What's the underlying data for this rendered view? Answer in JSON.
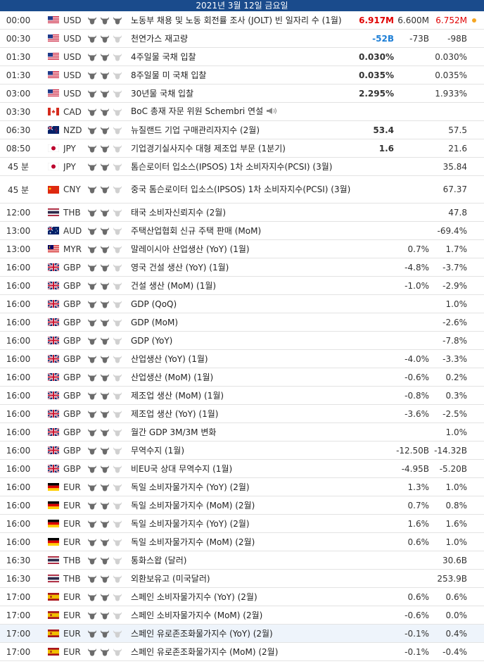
{
  "date_header": "2021년 3월 12일 금요일",
  "colors": {
    "bull_filled": "#6b6b6b",
    "bull_empty": "#d0d0d0",
    "header_bg": "#1a4b8c",
    "red": "#e00000",
    "blue": "#1e7fd6"
  },
  "rows": [
    {
      "time": "00:00",
      "flag": "us",
      "cur": "USD",
      "imp": 3,
      "event": "노동부 채용 및 노동 회전률 조사 (JOLT) 빈 일자리 수 (1월)",
      "actual": "6.917M",
      "actual_color": "red",
      "forecast": "6.600M",
      "previous": "6.752M",
      "previous_color": "red",
      "dot": true
    },
    {
      "time": "00:30",
      "flag": "us",
      "cur": "USD",
      "imp": 2,
      "event": "천연가스 재고량",
      "actual": "-52B",
      "actual_color": "blue",
      "forecast": "-73B",
      "previous": "-98B"
    },
    {
      "time": "01:30",
      "flag": "us",
      "cur": "USD",
      "imp": 2,
      "event": "4주일물 국채 입찰",
      "actual": "0.030%",
      "forecast": "",
      "previous": "0.030%"
    },
    {
      "time": "01:30",
      "flag": "us",
      "cur": "USD",
      "imp": 2,
      "event": "8주일물 미 국채 입찰",
      "actual": "0.035%",
      "forecast": "",
      "previous": "0.035%"
    },
    {
      "time": "03:00",
      "flag": "us",
      "cur": "USD",
      "imp": 2,
      "event": "30년물 국채 입찰",
      "actual": "2.295%",
      "forecast": "",
      "previous": "1.933%"
    },
    {
      "time": "03:30",
      "flag": "ca",
      "cur": "CAD",
      "imp": 2,
      "event": "BoC 총재 자문 위원 Schembri 연설",
      "speaker": true,
      "actual": "",
      "forecast": "",
      "previous": ""
    },
    {
      "time": "06:30",
      "flag": "nz",
      "cur": "NZD",
      "imp": 2,
      "event": "뉴질랜드 기업 구매관리자지수 (2월)",
      "actual": "53.4",
      "forecast": "",
      "previous": "57.5"
    },
    {
      "time": "08:50",
      "flag": "jp",
      "cur": "JPY",
      "imp": 2,
      "event": "기업경기실사지수 대형 제조업 부문 (1분기)",
      "actual": "1.6",
      "forecast": "",
      "previous": "21.6"
    },
    {
      "time": "45 분",
      "flag": "jp",
      "cur": "JPY",
      "imp": 2,
      "event": "톰슨로이터 입소스(IPSOS) 1차 소비자지수(PCSI) (3월)",
      "actual": "",
      "forecast": "",
      "previous": "35.84"
    },
    {
      "time": "45 분",
      "flag": "cn",
      "cur": "CNY",
      "imp": 2,
      "event": "중국 톰슨로이터 입소스(IPSOS) 1차 소비자지수(PCSI) (3월)",
      "tall": true,
      "actual": "",
      "forecast": "",
      "previous": "67.37"
    },
    {
      "time": "12:00",
      "flag": "th",
      "cur": "THB",
      "imp": 2,
      "event": "태국 소비자신뢰지수 (2월)",
      "actual": "",
      "forecast": "",
      "previous": "47.8"
    },
    {
      "time": "13:00",
      "flag": "au",
      "cur": "AUD",
      "imp": 2,
      "event": "주택산업협회 신규 주택 판매 (MoM)",
      "actual": "",
      "forecast": "",
      "previous": "-69.4%"
    },
    {
      "time": "13:00",
      "flag": "my",
      "cur": "MYR",
      "imp": 2,
      "event": "말레이시아 산업생산 (YoY) (1월)",
      "actual": "",
      "forecast": "0.7%",
      "previous": "1.7%"
    },
    {
      "time": "16:00",
      "flag": "gb",
      "cur": "GBP",
      "imp": 2,
      "event": "영국 건설 생산 (YoY) (1월)",
      "actual": "",
      "forecast": "-4.8%",
      "previous": "-3.7%"
    },
    {
      "time": "16:00",
      "flag": "gb",
      "cur": "GBP",
      "imp": 2,
      "event": "건설 생산 (MoM) (1월)",
      "actual": "",
      "forecast": "-1.0%",
      "previous": "-2.9%"
    },
    {
      "time": "16:00",
      "flag": "gb",
      "cur": "GBP",
      "imp": 2,
      "event": "GDP (QoQ)",
      "actual": "",
      "forecast": "",
      "previous": "1.0%"
    },
    {
      "time": "16:00",
      "flag": "gb",
      "cur": "GBP",
      "imp": 2,
      "event": "GDP (MoM)",
      "actual": "",
      "forecast": "",
      "previous": "-2.6%"
    },
    {
      "time": "16:00",
      "flag": "gb",
      "cur": "GBP",
      "imp": 2,
      "event": "GDP (YoY)",
      "actual": "",
      "forecast": "",
      "previous": "-7.8%"
    },
    {
      "time": "16:00",
      "flag": "gb",
      "cur": "GBP",
      "imp": 2,
      "event": "산업생산 (YoY) (1월)",
      "actual": "",
      "forecast": "-4.0%",
      "previous": "-3.3%"
    },
    {
      "time": "16:00",
      "flag": "gb",
      "cur": "GBP",
      "imp": 2,
      "event": "산업생산 (MoM) (1월)",
      "actual": "",
      "forecast": "-0.6%",
      "previous": "0.2%"
    },
    {
      "time": "16:00",
      "flag": "gb",
      "cur": "GBP",
      "imp": 2,
      "event": "제조업 생산 (MoM) (1월)",
      "actual": "",
      "forecast": "-0.8%",
      "previous": "0.3%"
    },
    {
      "time": "16:00",
      "flag": "gb",
      "cur": "GBP",
      "imp": 2,
      "event": "제조업 생산 (YoY) (1월)",
      "actual": "",
      "forecast": "-3.6%",
      "previous": "-2.5%"
    },
    {
      "time": "16:00",
      "flag": "gb",
      "cur": "GBP",
      "imp": 2,
      "event": "월간 GDP 3M/3M 변화",
      "actual": "",
      "forecast": "",
      "previous": "1.0%"
    },
    {
      "time": "16:00",
      "flag": "gb",
      "cur": "GBP",
      "imp": 2,
      "event": "무역수지 (1월)",
      "actual": "",
      "forecast": "-12.50B",
      "previous": "-14.32B"
    },
    {
      "time": "16:00",
      "flag": "gb",
      "cur": "GBP",
      "imp": 2,
      "event": "비EU국 상대 무역수지 (1월)",
      "actual": "",
      "forecast": "-4.95B",
      "previous": "-5.20B"
    },
    {
      "time": "16:00",
      "flag": "de",
      "cur": "EUR",
      "imp": 2,
      "event": "독일 소비자물가지수 (YoY) (2월)",
      "actual": "",
      "forecast": "1.3%",
      "previous": "1.0%"
    },
    {
      "time": "16:00",
      "flag": "de",
      "cur": "EUR",
      "imp": 2,
      "event": "독일 소비자물가지수 (MoM) (2월)",
      "actual": "",
      "forecast": "0.7%",
      "previous": "0.8%"
    },
    {
      "time": "16:00",
      "flag": "de",
      "cur": "EUR",
      "imp": 2,
      "event": "독일 소비자물가지수 (YoY) (2월)",
      "actual": "",
      "forecast": "1.6%",
      "previous": "1.6%"
    },
    {
      "time": "16:00",
      "flag": "de",
      "cur": "EUR",
      "imp": 2,
      "event": "독일 소비자물가지수 (MoM) (2월)",
      "actual": "",
      "forecast": "0.6%",
      "previous": "1.0%"
    },
    {
      "time": "16:30",
      "flag": "th",
      "cur": "THB",
      "imp": 2,
      "event": "통화스왑 (달러)",
      "actual": "",
      "forecast": "",
      "previous": "30.6B"
    },
    {
      "time": "16:30",
      "flag": "th",
      "cur": "THB",
      "imp": 2,
      "event": "외환보유고 (미국달러)",
      "actual": "",
      "forecast": "",
      "previous": "253.9B"
    },
    {
      "time": "17:00",
      "flag": "es",
      "cur": "EUR",
      "imp": 2,
      "event": "스페인 소비자물가지수 (YoY) (2월)",
      "actual": "",
      "forecast": "0.6%",
      "previous": "0.6%"
    },
    {
      "time": "17:00",
      "flag": "es",
      "cur": "EUR",
      "imp": 2,
      "event": "스페인 소비자물가지수 (MoM) (2월)",
      "actual": "",
      "forecast": "-0.6%",
      "previous": "0.0%"
    },
    {
      "time": "17:00",
      "flag": "es",
      "cur": "EUR",
      "imp": 2,
      "event": "스페인 유로존조화물가지수 (YoY) (2월)",
      "highlight": true,
      "actual": "",
      "forecast": "-0.1%",
      "previous": "0.4%"
    },
    {
      "time": "17:00",
      "flag": "es",
      "cur": "EUR",
      "imp": 2,
      "event": "스페인 유로존조화물가지수 (MoM) (2월)",
      "actual": "",
      "forecast": "-0.1%",
      "previous": "-0.4%"
    }
  ]
}
